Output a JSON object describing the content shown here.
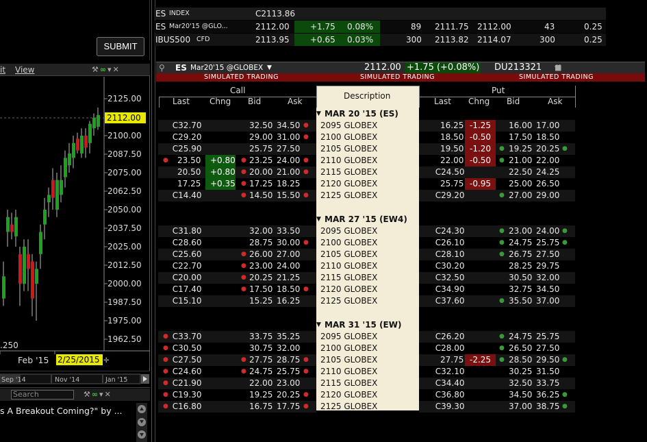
{
  "order_panel": {
    "submit_label": "SUBMIT"
  },
  "chart": {
    "menu": {
      "edit_fragment": "it",
      "view_label": "View"
    },
    "y_ticks": [
      "2125.00",
      "2100.00",
      "2087.50",
      "2075.00",
      "2062.50",
      "2050.00",
      "2037.50",
      "2025.00",
      "2012.50",
      "2000.00",
      "1987.50",
      "1975.00",
      "1962.50"
    ],
    "last_price": "2112.00",
    "left_value": ".250",
    "date_label": "Feb '15",
    "cursor_date": "2/25/2015",
    "scroll_labels": [
      "Sep '14",
      "Nov '14",
      "Jan '15"
    ],
    "colors": {
      "up": "#1fa01f",
      "down": "#d01818",
      "price_tag": "#e8e800"
    }
  },
  "news": {
    "search_placeholder": "Search",
    "headline": "s A Breakout Coming?\"  by ..."
  },
  "quotes": [
    {
      "symbol": "ES",
      "sub": "INDEX",
      "last": "C2113.86",
      "chg": "",
      "pct": "",
      "bsize": "",
      "bid": "",
      "ask": "",
      "asize": "",
      "tick": ""
    },
    {
      "symbol": "ES",
      "sub": "Mar20'15 @GLO...",
      "last": "2112.00",
      "chg": "+1.75",
      "pct": "0.08%",
      "bsize": "89",
      "bid": "2111.75",
      "ask": "2112.00",
      "asize": "43",
      "tick": "0.25"
    },
    {
      "symbol": "IBUS500",
      "sub": "CFD",
      "last": "2113.95",
      "chg": "+0.65",
      "pct": "0.03%",
      "bsize": "300",
      "bid": "2113.82",
      "ask": "2114.07",
      "asize": "300",
      "tick": "0.25"
    }
  ],
  "chain": {
    "title_symbol": "ES",
    "title_contract": "Mar20'15 @GLOBEX",
    "title_price": "2112.00",
    "title_change": "+1.75 (+0.08%)",
    "account": "DU213321",
    "sim_label": "SIMULATED TRADING",
    "call_header": "Call",
    "put_header": "Put",
    "desc_header": "Description",
    "col_last": "Last",
    "col_chng": "Chng",
    "col_bid": "Bid",
    "col_ask": "Ask",
    "sections": [
      {
        "title": "MAR 20 '15 (ES)",
        "rows": [
          {
            "cd": "",
            "cl": "C32.70",
            "cc": "",
            "cbd": "",
            "cb": "32.50",
            "ca": "34.50",
            "cad": "r",
            "desc": "2095 GLOBEX",
            "pl": "16.25",
            "pc": "-1.25",
            "pbd": "",
            "pb": "16.00",
            "pa": "17.00",
            "pad": ""
          },
          {
            "cd": "",
            "cl": "C29.20",
            "cc": "",
            "cbd": "",
            "cb": "29.00",
            "ca": "31.00",
            "cad": "r",
            "desc": "2100 GLOBEX",
            "pl": "18.50",
            "pc": "-0.50",
            "pbd": "",
            "pb": "17.50",
            "pa": "18.50",
            "pad": ""
          },
          {
            "cd": "",
            "cl": "C25.90",
            "cc": "",
            "cbd": "",
            "cb": "25.75",
            "ca": "27.50",
            "cad": "",
            "desc": "2105 GLOBEX",
            "pl": "19.50",
            "pc": "-1.20",
            "pbd": "g",
            "pb": "19.25",
            "pa": "20.25",
            "pad": "g"
          },
          {
            "cd": "r",
            "cl": "23.50",
            "cc": "+0.80",
            "cbd": "r",
            "cb": "23.25",
            "ca": "24.00",
            "cad": "r",
            "desc": "2110 GLOBEX",
            "pl": "22.00",
            "pc": "-0.50",
            "pbd": "g",
            "pb": "21.00",
            "pa": "22.00",
            "pad": ""
          },
          {
            "cd": "",
            "cl": "20.50",
            "cc": "+0.80",
            "cbd": "r",
            "cb": "20.00",
            "ca": "21.00",
            "cad": "r",
            "desc": "2115 GLOBEX",
            "pl": "C24.50",
            "pc": "",
            "pbd": "",
            "pb": "22.50",
            "pa": "24.25",
            "pad": ""
          },
          {
            "cd": "",
            "cl": "17.25",
            "cc": "+0.35",
            "cbd": "r",
            "cb": "17.25",
            "ca": "18.25",
            "cad": "",
            "desc": "2120 GLOBEX",
            "pl": "25.75",
            "pc": "-0.95",
            "pbd": "",
            "pb": "25.00",
            "pa": "26.50",
            "pad": ""
          },
          {
            "cd": "",
            "cl": "C14.40",
            "cc": "",
            "cbd": "r",
            "cb": "14.50",
            "ca": "15.50",
            "cad": "r",
            "desc": "2125 GLOBEX",
            "pl": "C29.20",
            "pc": "",
            "pbd": "g",
            "pb": "27.00",
            "pa": "29.00",
            "pad": ""
          }
        ]
      },
      {
        "title": "MAR 27 '15 (EW4)",
        "rows": [
          {
            "cd": "",
            "cl": "C31.80",
            "cc": "",
            "cbd": "",
            "cb": "32.00",
            "ca": "33.50",
            "cad": "",
            "desc": "2095 GLOBEX",
            "pl": "C24.30",
            "pc": "",
            "pbd": "g",
            "pb": "23.00",
            "pa": "24.00",
            "pad": "g"
          },
          {
            "cd": "",
            "cl": "C28.60",
            "cc": "",
            "cbd": "",
            "cb": "28.75",
            "ca": "30.00",
            "cad": "r",
            "desc": "2100 GLOBEX",
            "pl": "C26.10",
            "pc": "",
            "pbd": "g",
            "pb": "24.75",
            "pa": "25.75",
            "pad": "g"
          },
          {
            "cd": "",
            "cl": "C25.60",
            "cc": "",
            "cbd": "r",
            "cb": "26.00",
            "ca": "27.00",
            "cad": "",
            "desc": "2105 GLOBEX",
            "pl": "C28.10",
            "pc": "",
            "pbd": "g",
            "pb": "26.75",
            "pa": "27.50",
            "pad": ""
          },
          {
            "cd": "",
            "cl": "C22.70",
            "cc": "",
            "cbd": "r",
            "cb": "23.00",
            "ca": "24.00",
            "cad": "",
            "desc": "2110 GLOBEX",
            "pl": "C30.20",
            "pc": "",
            "pbd": "",
            "pb": "28.25",
            "pa": "29.75",
            "pad": ""
          },
          {
            "cd": "",
            "cl": "C20.00",
            "cc": "",
            "cbd": "r",
            "cb": "20.25",
            "ca": "21.25",
            "cad": "",
            "desc": "2115 GLOBEX",
            "pl": "C32.50",
            "pc": "",
            "pbd": "",
            "pb": "30.50",
            "pa": "32.00",
            "pad": ""
          },
          {
            "cd": "",
            "cl": "C17.40",
            "cc": "",
            "cbd": "r",
            "cb": "17.50",
            "ca": "18.50",
            "cad": "r",
            "desc": "2120 GLOBEX",
            "pl": "C34.90",
            "pc": "",
            "pbd": "",
            "pb": "32.75",
            "pa": "34.50",
            "pad": ""
          },
          {
            "cd": "",
            "cl": "C15.10",
            "cc": "",
            "cbd": "",
            "cb": "15.25",
            "ca": "16.25",
            "cad": "",
            "desc": "2125 GLOBEX",
            "pl": "C37.60",
            "pc": "",
            "pbd": "g",
            "pb": "35.50",
            "pa": "37.00",
            "pad": ""
          }
        ]
      },
      {
        "title": "MAR 31 '15 (EW)",
        "rows": [
          {
            "cd": "r",
            "cl": "C33.70",
            "cc": "",
            "cbd": "",
            "cb": "33.75",
            "ca": "35.25",
            "cad": "",
            "desc": "2095 GLOBEX",
            "pl": "C26.20",
            "pc": "",
            "pbd": "g",
            "pb": "24.75",
            "pa": "25.75",
            "pad": ""
          },
          {
            "cd": "r",
            "cl": "C30.50",
            "cc": "",
            "cbd": "",
            "cb": "30.75",
            "ca": "32.00",
            "cad": "",
            "desc": "2100 GLOBEX",
            "pl": "C28.00",
            "pc": "",
            "pbd": "g",
            "pb": "26.50",
            "pa": "27.50",
            "pad": ""
          },
          {
            "cd": "r",
            "cl": "C27.50",
            "cc": "",
            "cbd": "r",
            "cb": "27.75",
            "ca": "28.75",
            "cad": "r",
            "desc": "2105 GLOBEX",
            "pl": "27.75",
            "pc": "-2.25",
            "pbd": "g",
            "pb": "28.50",
            "pa": "29.50",
            "pad": "g"
          },
          {
            "cd": "r",
            "cl": "C24.60",
            "cc": "",
            "cbd": "r",
            "cb": "24.75",
            "ca": "25.75",
            "cad": "r",
            "desc": "2110 GLOBEX",
            "pl": "C32.10",
            "pc": "",
            "pbd": "",
            "pb": "30.25",
            "pa": "31.50",
            "pad": ""
          },
          {
            "cd": "r",
            "cl": "C21.90",
            "cc": "",
            "cbd": "",
            "cb": "22.00",
            "ca": "23.00",
            "cad": "",
            "desc": "2115 GLOBEX",
            "pl": "C34.40",
            "pc": "",
            "pbd": "",
            "pb": "32.50",
            "pa": "33.75",
            "pad": ""
          },
          {
            "cd": "r",
            "cl": "C19.30",
            "cc": "",
            "cbd": "",
            "cb": "19.25",
            "ca": "20.25",
            "cad": "r",
            "desc": "2120 GLOBEX",
            "pl": "C36.80",
            "pc": "",
            "pbd": "",
            "pb": "34.50",
            "pa": "36.25",
            "pad": "g"
          },
          {
            "cd": "r",
            "cl": "C16.80",
            "cc": "",
            "cbd": "",
            "cb": "16.75",
            "ca": "17.75",
            "cad": "r",
            "desc": "2125 GLOBEX",
            "pl": "C39.30",
            "pc": "",
            "pbd": "",
            "pb": "37.00",
            "pa": "38.75",
            "pad": "g"
          }
        ]
      }
    ]
  }
}
